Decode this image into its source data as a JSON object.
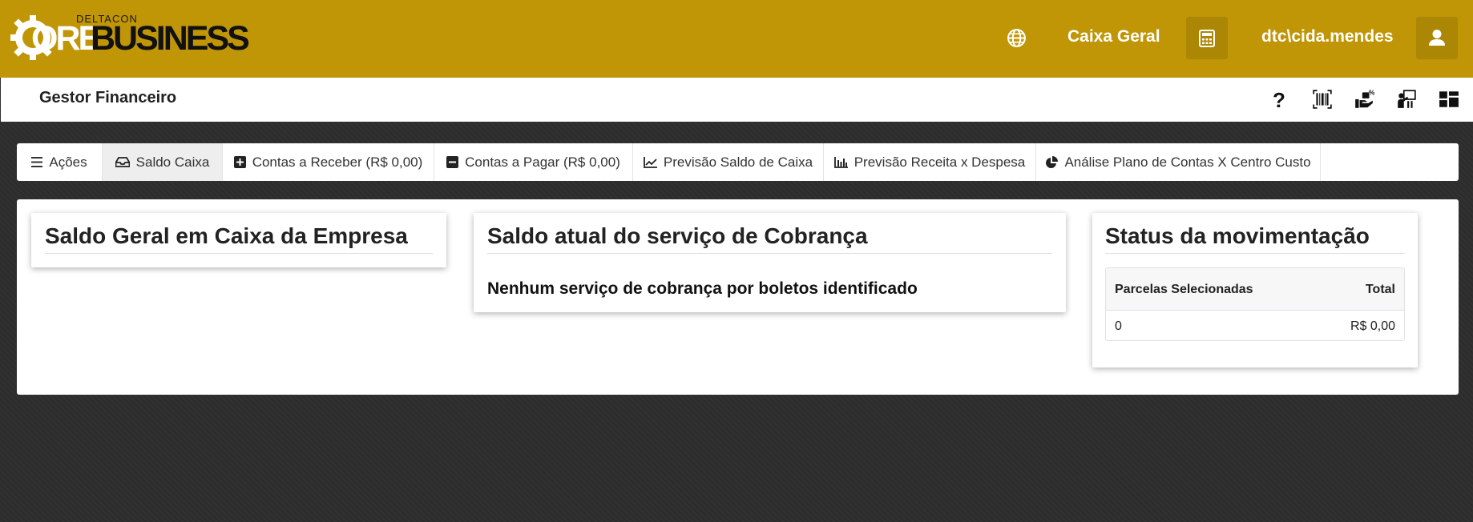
{
  "header": {
    "logo": {
      "small": "DELTACON",
      "part1": "ORE",
      "part2": "BUSINESS"
    },
    "caixa_label": "Caixa Geral",
    "user_name": "dtc\\cida.mendes",
    "icons": [
      "globe-icon",
      "calculator-icon",
      "user-icon"
    ]
  },
  "subbar": {
    "title": "Gestor Financeiro",
    "icons": [
      "help-icon",
      "barcode-icon",
      "hand-money-icon",
      "person-board-icon",
      "dashboard-icon"
    ]
  },
  "tabs": [
    {
      "label": "Ações",
      "icon": "bars-icon"
    },
    {
      "label": "Saldo Caixa",
      "icon": "inbox-icon",
      "active": true
    },
    {
      "label": "Contas a Receber (R$ 0,00)",
      "icon": "plus-square-icon"
    },
    {
      "label": "Contas a Pagar (R$ 0,00)",
      "icon": "minus-square-icon"
    },
    {
      "label": "Previsão Saldo de Caixa",
      "icon": "line-chart-icon"
    },
    {
      "label": "Previsão Receita x Despesa",
      "icon": "bar-chart-icon"
    },
    {
      "label": "Análise Plano de Contas X Centro Custo",
      "icon": "pie-chart-icon"
    }
  ],
  "cards": {
    "saldo_geral": {
      "title": "Saldo Geral em Caixa da Empresa"
    },
    "cobranca": {
      "title": "Saldo atual do serviço de Cobrança",
      "message": "Nenhum serviço de cobrança por boletos identificado"
    },
    "status": {
      "title": "Status da movimentação",
      "columns": [
        "Parcelas Selecionadas",
        "Total"
      ],
      "rows": [
        {
          "parcelas": "0",
          "total": "R$ 0,00"
        }
      ]
    }
  },
  "colors": {
    "header_bg": "#c09606",
    "header_button_bg": "#ac8705",
    "page_bg": "#2d2d2d",
    "active_tab_bg": "#eeeeee"
  }
}
